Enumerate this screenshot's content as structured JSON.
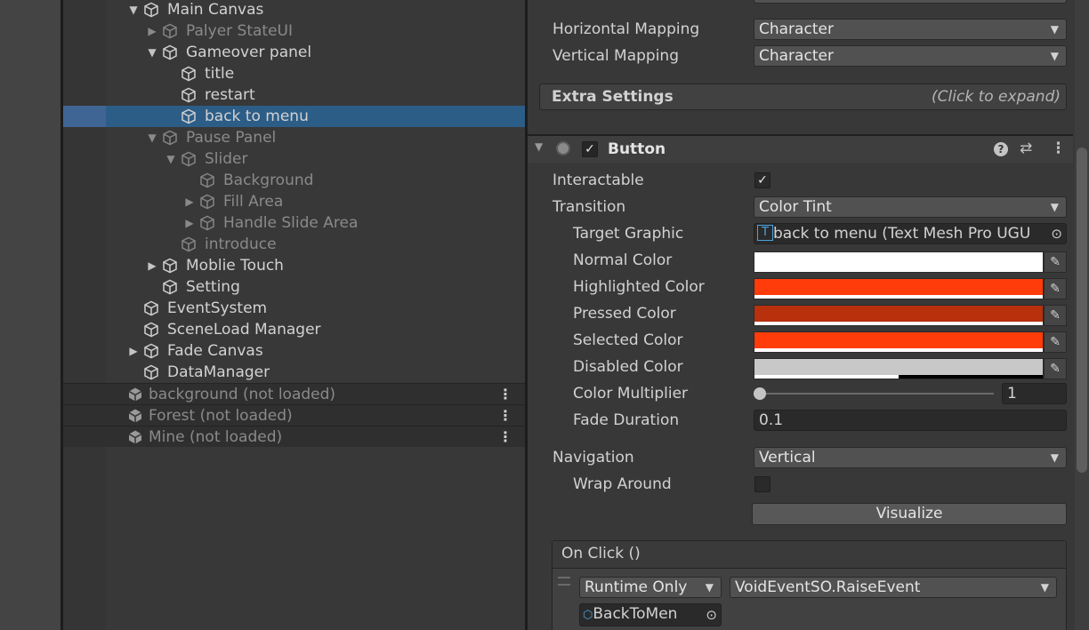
{
  "hierarchy": {
    "items": [
      {
        "label": "Main Canvas",
        "arrow": "▼",
        "dim": false
      },
      {
        "label": "Palyer StateUI",
        "arrow": "▶",
        "dim": true
      },
      {
        "label": "Gameover panel",
        "arrow": "▼",
        "dim": false
      },
      {
        "label": "title",
        "arrow": "",
        "dim": false
      },
      {
        "label": "restart",
        "arrow": "",
        "dim": false
      },
      {
        "label": "back to menu",
        "arrow": "",
        "dim": false,
        "selected": true
      },
      {
        "label": "Pause Panel",
        "arrow": "▼",
        "dim": true
      },
      {
        "label": "Slider",
        "arrow": "▼",
        "dim": true
      },
      {
        "label": "Background",
        "arrow": "",
        "dim": true
      },
      {
        "label": "Fill Area",
        "arrow": "▶",
        "dim": true
      },
      {
        "label": "Handle Slide Area",
        "arrow": "▶",
        "dim": true
      },
      {
        "label": "introduce",
        "arrow": "",
        "dim": true
      },
      {
        "label": "Moblie Touch",
        "arrow": "▶",
        "dim": false
      },
      {
        "label": "Setting",
        "arrow": "",
        "dim": false
      },
      {
        "label": "EventSystem",
        "arrow": "",
        "dim": false
      },
      {
        "label": "SceneLoad Manager",
        "arrow": "",
        "dim": false
      },
      {
        "label": "Fade Canvas",
        "arrow": "▶",
        "dim": false
      },
      {
        "label": "DataManager",
        "arrow": "",
        "dim": false
      }
    ],
    "scenes": [
      {
        "label": "background (not loaded)"
      },
      {
        "label": "Forest (not loaded)"
      },
      {
        "label": "Mine (not loaded)"
      }
    ]
  },
  "inspector": {
    "horizontal_mapping": {
      "label": "Horizontal Mapping",
      "value": "Character"
    },
    "vertical_mapping": {
      "label": "Vertical Mapping",
      "value": "Character"
    },
    "extra_settings": {
      "label": "Extra Settings",
      "hint": "(Click to expand)"
    },
    "button_component": {
      "title": "Button",
      "interactable": {
        "label": "Interactable",
        "checked": true
      },
      "transition": {
        "label": "Transition",
        "value": "Color Tint"
      },
      "target_graphic": {
        "label": "Target Graphic",
        "value": "back to menu (Text Mesh Pro UGU"
      },
      "colors": [
        {
          "label": "Normal Color",
          "color": "#ffffff",
          "alpha": 1.0
        },
        {
          "label": "Highlighted Color",
          "color": "#ff3c0a",
          "alpha": 1.0
        },
        {
          "label": "Pressed Color",
          "color": "#b8300c",
          "alpha": 1.0
        },
        {
          "label": "Selected Color",
          "color": "#ff3c0a",
          "alpha": 1.0
        },
        {
          "label": "Disabled Color",
          "color": "#c8c8c8",
          "alpha": 0.5
        }
      ],
      "color_multiplier": {
        "label": "Color Multiplier",
        "value": "1",
        "slider_fraction": 0.0
      },
      "fade_duration": {
        "label": "Fade Duration",
        "value": "0.1"
      },
      "navigation": {
        "label": "Navigation",
        "value": "Vertical"
      },
      "wrap_around": {
        "label": "Wrap Around",
        "checked": false
      },
      "visualize_label": "Visualize",
      "on_click": {
        "title": "On Click ()",
        "runtime": "Runtime Only",
        "function": "VoidEventSO.RaiseEvent",
        "object": "BackToMen"
      }
    }
  },
  "icons": {
    "gameobject": "cube-icon",
    "scene": "unity-scene-icon",
    "help": "help-icon",
    "presets": "presets-icon",
    "menu": "kebab-menu-icon",
    "eyedropper": "eyedropper-icon",
    "object_picker": "target-icon"
  }
}
